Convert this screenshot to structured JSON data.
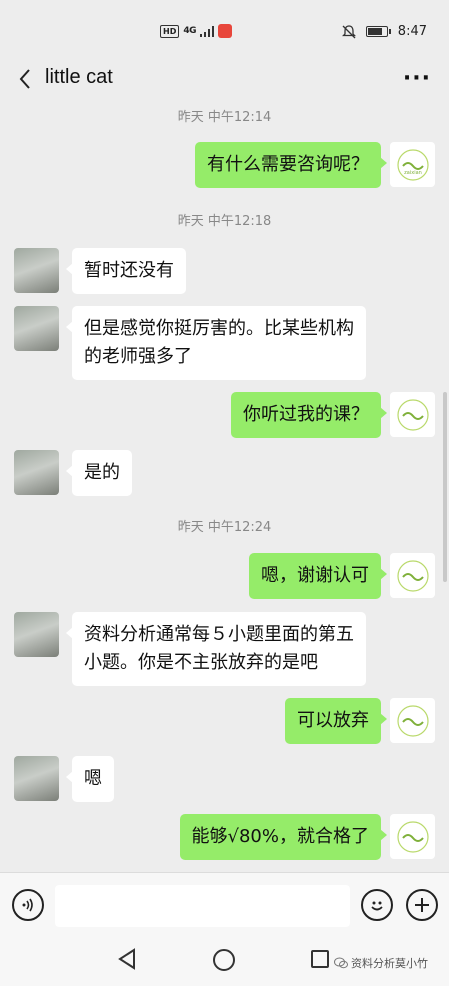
{
  "status": {
    "hd": "HD",
    "signal": "4G",
    "time": "8:47"
  },
  "header": {
    "title": "little  cat",
    "more": "···"
  },
  "messages": [
    {
      "type": "time",
      "text": "昨天 中午12:14"
    },
    {
      "type": "me",
      "text": "有什么需要咨询呢？"
    },
    {
      "type": "time",
      "text": "昨天 中午12:18"
    },
    {
      "type": "other",
      "text": "暂时还没有"
    },
    {
      "type": "other",
      "text": "但是感觉你挺厉害的。比某些机构\n的老师强多了"
    },
    {
      "type": "me",
      "text": "你听过我的课？"
    },
    {
      "type": "other",
      "text": "是的"
    },
    {
      "type": "time",
      "text": "昨天 中午12:24"
    },
    {
      "type": "me",
      "text": "嗯，谢谢认可"
    },
    {
      "type": "other",
      "text": "资料分析通常每５小题里面的第五\n小题。你是不主张放弃的是吧"
    },
    {
      "type": "me",
      "text": "可以放弃"
    },
    {
      "type": "other",
      "text": "嗯"
    },
    {
      "type": "me",
      "text": "能够√80%，就合格了"
    }
  ],
  "input": {
    "placeholder": ""
  },
  "watermark": "资料分析莫小竹",
  "colors": {
    "me_bubble": "#95ec69",
    "other_bubble": "#ffffff",
    "background": "#ededed"
  },
  "icons": [
    "back-arrow-icon",
    "more-dots-icon",
    "voice-icon",
    "emoji-icon",
    "plus-icon",
    "nav-back-icon",
    "nav-home-icon",
    "nav-recent-icon"
  ]
}
